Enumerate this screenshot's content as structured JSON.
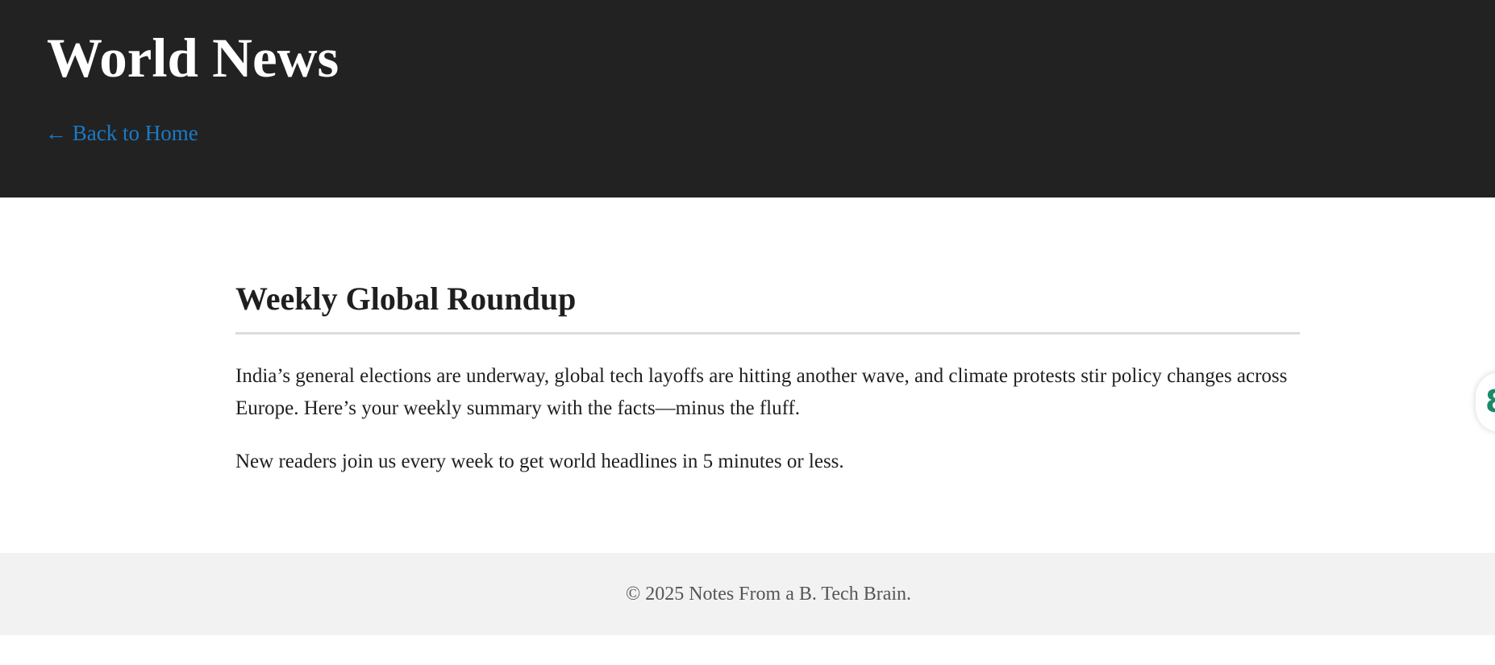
{
  "header": {
    "site_title": "World News",
    "back_link": "← Back to Home",
    "background_color": "#222222",
    "link_color": "#1a7ac7"
  },
  "article": {
    "title": "Weekly Global Roundup",
    "paragraphs": [
      "India’s general elections are underway, global tech layoffs are hitting another wave, and climate protests stir policy changes across Europe. Here’s your weekly summary with the facts—minus the fluff.",
      "New readers join us every week to get world headlines in 5 minutes or less."
    ]
  },
  "footer": {
    "text": "© 2025 Notes From a B. Tech Brain.",
    "background_color": "#f2f2f2"
  },
  "side_widget": {
    "icon": "floating-action-icon",
    "accent_color": "#1b8a6b"
  }
}
